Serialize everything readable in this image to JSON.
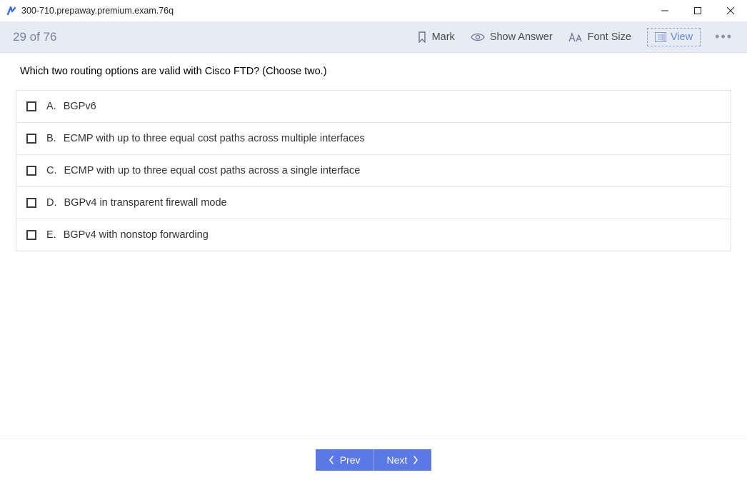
{
  "window": {
    "title": "300-710.prepaway.premium.exam.76q"
  },
  "toolbar": {
    "progress": "29 of 76",
    "mark_label": "Mark",
    "show_answer_label": "Show Answer",
    "font_size_label": "Font Size",
    "view_label": "View"
  },
  "question": {
    "text": "Which two routing options are valid with Cisco FTD? (Choose two.)",
    "options": [
      {
        "letter": "A.",
        "text": "BGPv6"
      },
      {
        "letter": "B.",
        "text": "ECMP with up to three equal cost paths across multiple interfaces"
      },
      {
        "letter": "C.",
        "text": "ECMP with up to three equal cost paths across a single interface"
      },
      {
        "letter": "D.",
        "text": "BGPv4 in transparent firewall mode"
      },
      {
        "letter": "E.",
        "text": "BGPv4 with nonstop forwarding"
      }
    ]
  },
  "footer": {
    "prev_label": "Prev",
    "next_label": "Next"
  }
}
